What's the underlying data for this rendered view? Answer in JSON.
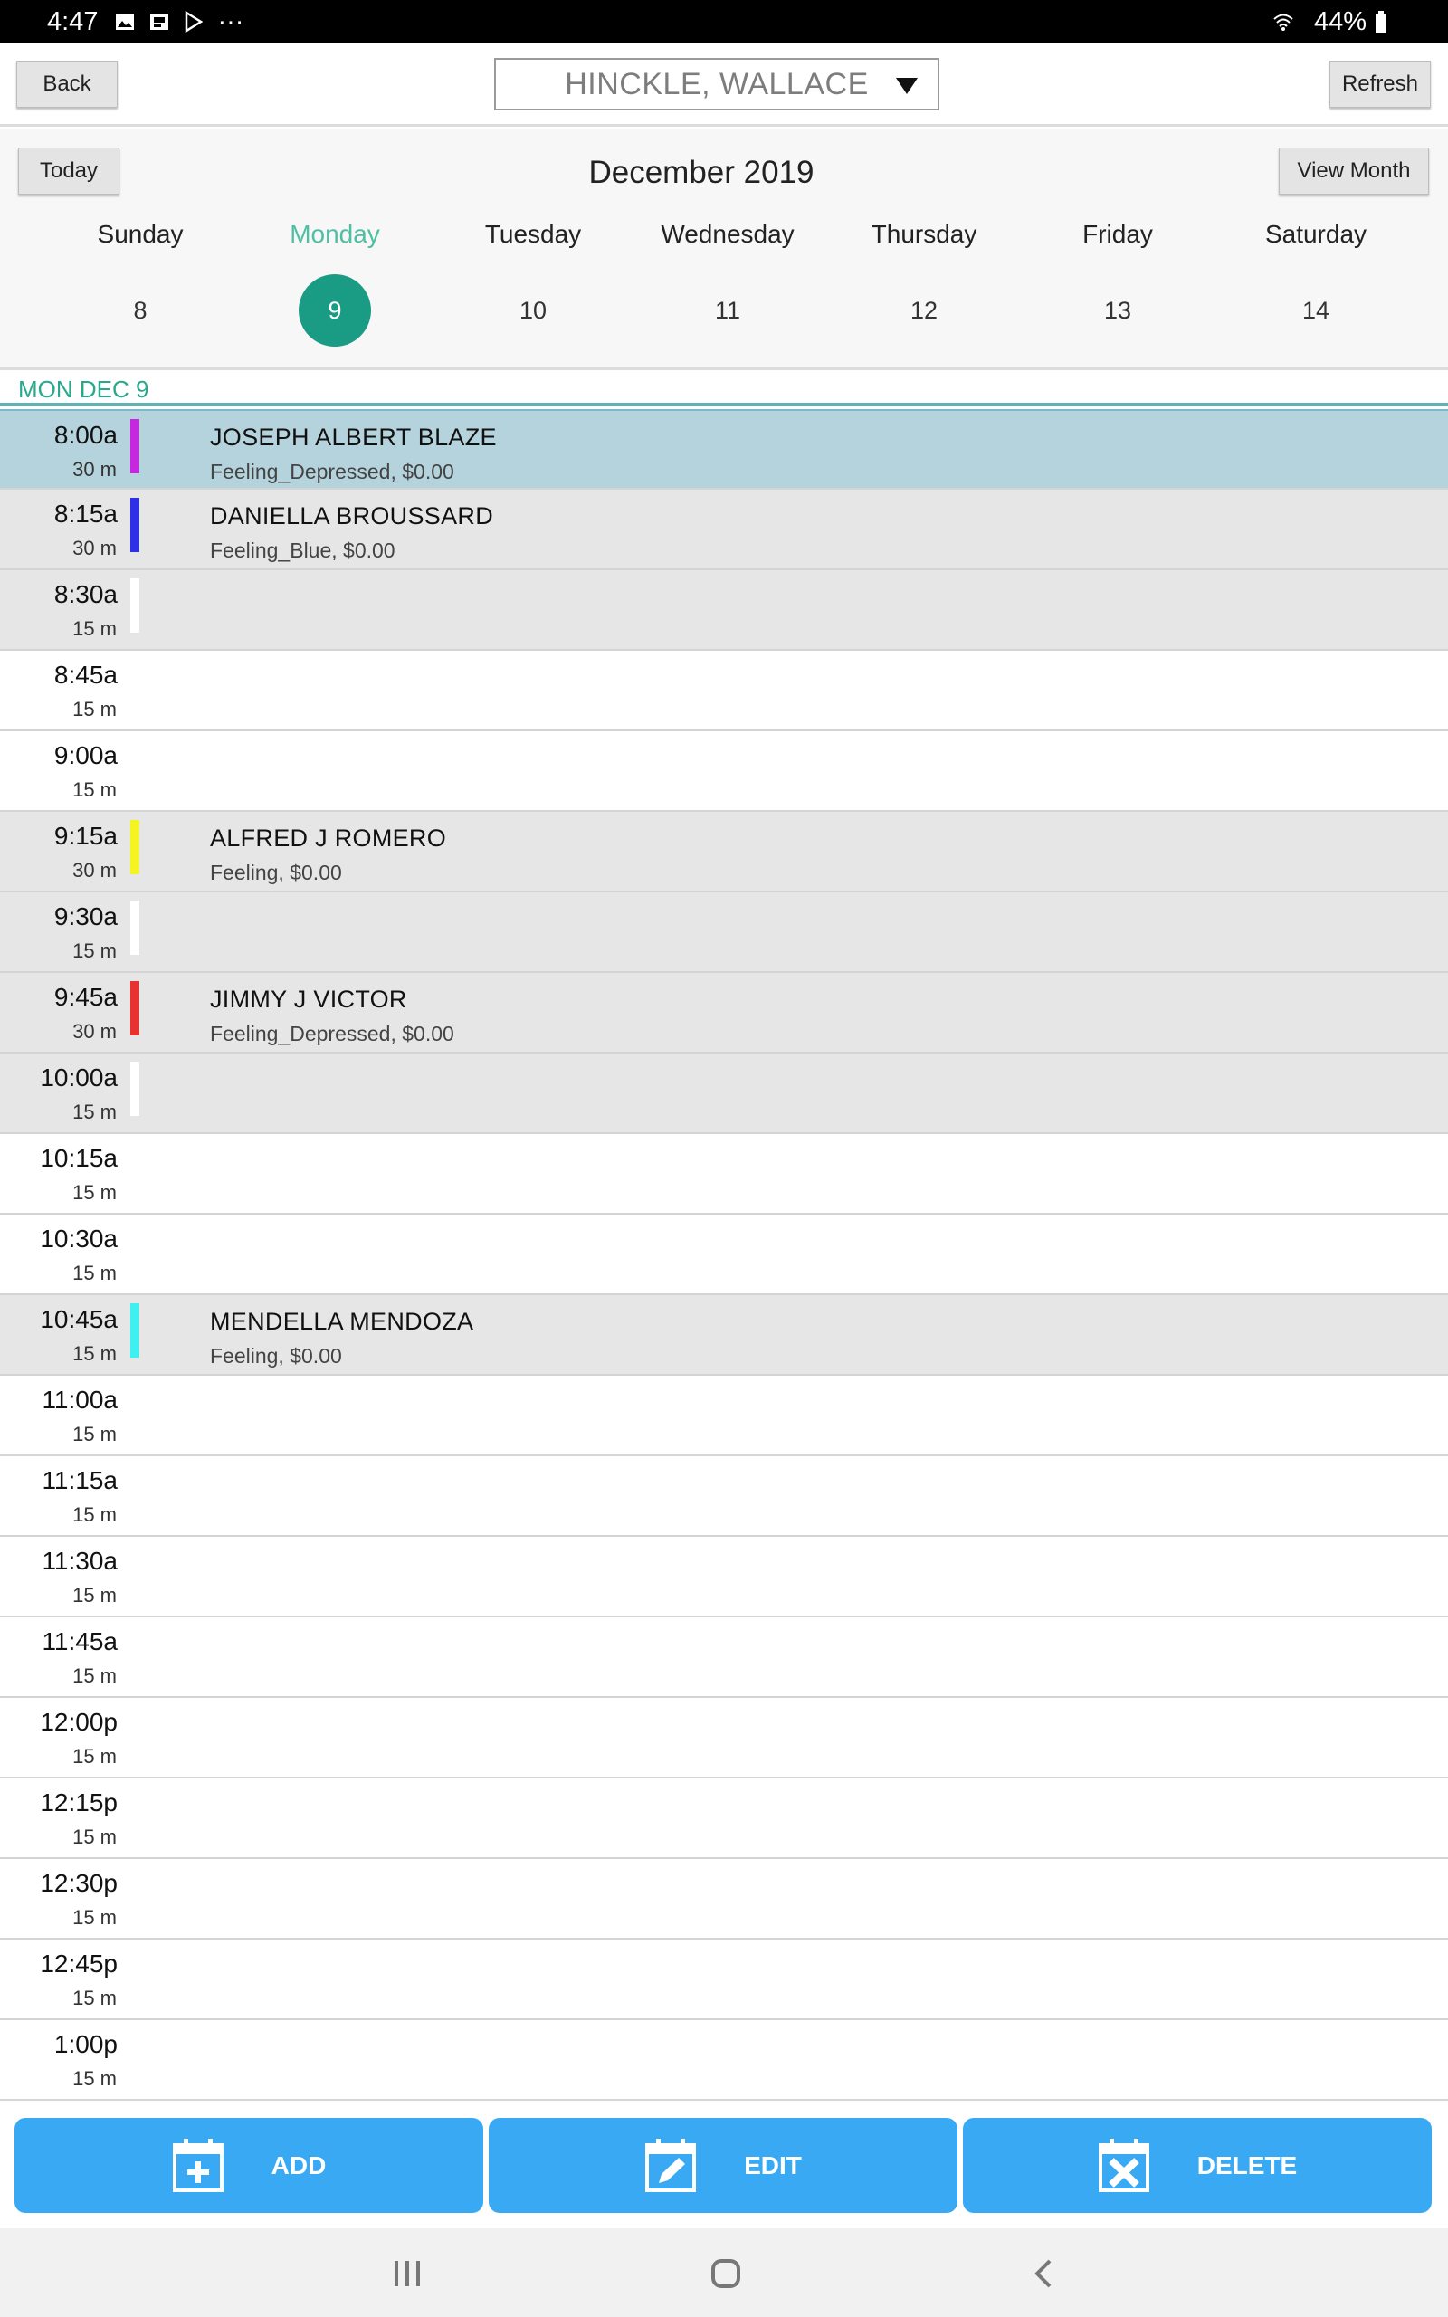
{
  "statusbar": {
    "time": "4:47",
    "extra": "···",
    "battery": "44%"
  },
  "header": {
    "back_label": "Back",
    "refresh_label": "Refresh",
    "doctor_selected": "HINCKLE, WALLACE"
  },
  "calendar": {
    "today_label": "Today",
    "view_month_label": "View Month",
    "month_title": "December 2019",
    "days": [
      {
        "name": "Sunday",
        "num": "8"
      },
      {
        "name": "Monday",
        "num": "9"
      },
      {
        "name": "Tuesday",
        "num": "10"
      },
      {
        "name": "Wednesday",
        "num": "11"
      },
      {
        "name": "Thursday",
        "num": "12"
      },
      {
        "name": "Friday",
        "num": "13"
      },
      {
        "name": "Saturday",
        "num": "14"
      }
    ],
    "selected_day": "Monday"
  },
  "date_label": "MON DEC 9",
  "slots": [
    {
      "time": "8:00a",
      "duration": "30 m",
      "name": "JOSEPH ALBERT BLAZE",
      "desc": "Feeling_Depressed, $0.00",
      "color": "#c628e0",
      "state": "selected"
    },
    {
      "time": "8:15a",
      "duration": "30 m",
      "name": "DANIELLA BROUSSARD",
      "desc": "Feeling_Blue, $0.00",
      "color": "#2f2fe8",
      "state": "shaded"
    },
    {
      "time": "8:30a",
      "duration": "15 m",
      "name": "",
      "desc": "",
      "color": "#ffffff",
      "state": "shaded"
    },
    {
      "time": "8:45a",
      "duration": "15 m",
      "name": "",
      "desc": "",
      "color": "",
      "state": "plain"
    },
    {
      "time": "9:00a",
      "duration": "15 m",
      "name": "",
      "desc": "",
      "color": "",
      "state": "plain"
    },
    {
      "time": "9:15a",
      "duration": "30 m",
      "name": "ALFRED J ROMERO",
      "desc": "Feeling, $0.00",
      "color": "#f4f421",
      "state": "shaded"
    },
    {
      "time": "9:30a",
      "duration": "15 m",
      "name": "",
      "desc": "",
      "color": "#ffffff",
      "state": "shaded"
    },
    {
      "time": "9:45a",
      "duration": "30 m",
      "name": "JIMMY J VICTOR",
      "desc": "Feeling_Depressed, $0.00",
      "color": "#e83232",
      "state": "shaded"
    },
    {
      "time": "10:00a",
      "duration": "15 m",
      "name": "",
      "desc": "",
      "color": "#ffffff",
      "state": "shaded"
    },
    {
      "time": "10:15a",
      "duration": "15 m",
      "name": "",
      "desc": "",
      "color": "",
      "state": "plain"
    },
    {
      "time": "10:30a",
      "duration": "15 m",
      "name": "",
      "desc": "",
      "color": "",
      "state": "plain"
    },
    {
      "time": "10:45a",
      "duration": "15 m",
      "name": "MENDELLA MENDOZA",
      "desc": "Feeling, $0.00",
      "color": "#3ef0f0",
      "state": "shaded"
    },
    {
      "time": "11:00a",
      "duration": "15 m",
      "name": "",
      "desc": "",
      "color": "",
      "state": "plain"
    },
    {
      "time": "11:15a",
      "duration": "15 m",
      "name": "",
      "desc": "",
      "color": "",
      "state": "plain"
    },
    {
      "time": "11:30a",
      "duration": "15 m",
      "name": "",
      "desc": "",
      "color": "",
      "state": "plain"
    },
    {
      "time": "11:45a",
      "duration": "15 m",
      "name": "",
      "desc": "",
      "color": "",
      "state": "plain"
    },
    {
      "time": "12:00p",
      "duration": "15 m",
      "name": "",
      "desc": "",
      "color": "",
      "state": "plain"
    },
    {
      "time": "12:15p",
      "duration": "15 m",
      "name": "",
      "desc": "",
      "color": "",
      "state": "plain"
    },
    {
      "time": "12:30p",
      "duration": "15 m",
      "name": "",
      "desc": "",
      "color": "",
      "state": "plain"
    },
    {
      "time": "12:45p",
      "duration": "15 m",
      "name": "",
      "desc": "",
      "color": "",
      "state": "plain"
    },
    {
      "time": "1:00p",
      "duration": "15 m",
      "name": "",
      "desc": "",
      "color": "",
      "state": "plain"
    }
  ],
  "actions": {
    "add_label": "ADD",
    "edit_label": "EDIT",
    "delete_label": "DELETE"
  },
  "colors": {
    "accent": "#1a9b83",
    "button_blue": "#3aa9f4",
    "selected_row": "#b5d3dc"
  },
  "icons": [
    "gallery-icon",
    "image-icon",
    "play-store-icon",
    "wifi-icon",
    "battery-icon",
    "calendar-add-icon",
    "calendar-edit-icon",
    "calendar-delete-icon",
    "recents-icon",
    "home-icon",
    "back-nav-icon"
  ]
}
